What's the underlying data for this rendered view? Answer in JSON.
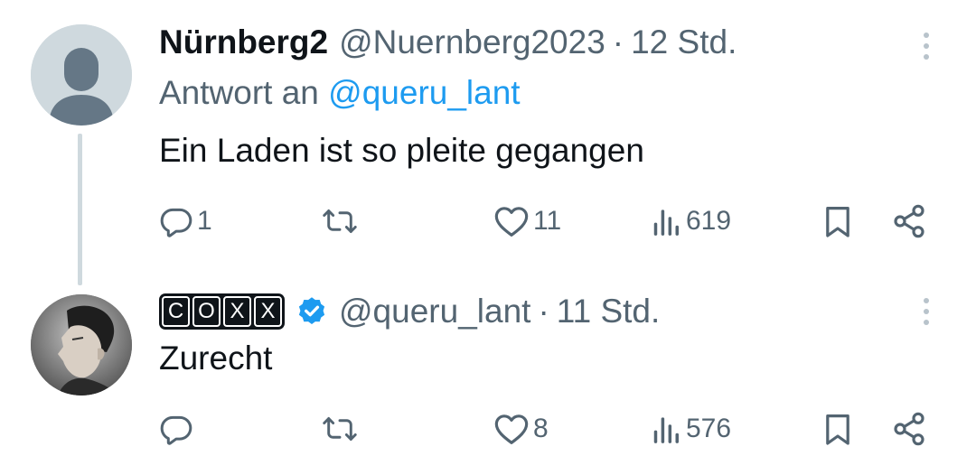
{
  "tweets": [
    {
      "display_name": "Nürnberg2",
      "handle": "@Nuernberg2023",
      "separator": "·",
      "time": "12 Std.",
      "reply_prefix": "Antwort an",
      "reply_mention": "@queru_lant",
      "text": "Ein Laden ist so pleite gegangen",
      "avatar_icon": "default-avatar-icon",
      "counts": {
        "replies": "1",
        "retweets": "",
        "likes": "11",
        "views": "619"
      }
    },
    {
      "display_name_letters": [
        "C",
        "O",
        "X",
        "X"
      ],
      "verified_icon": "verified-badge-icon",
      "handle": "@queru_lant",
      "separator": "·",
      "time": "11 Std.",
      "text": "Zurecht",
      "avatar_icon": "profile-photo",
      "counts": {
        "replies": "",
        "retweets": "",
        "likes": "8",
        "views": "576"
      }
    }
  ],
  "icons": {
    "reply": "reply-icon",
    "retweet": "retweet-icon",
    "like": "heart-icon",
    "views": "views-icon",
    "bookmark": "bookmark-icon",
    "share": "share-icon",
    "more": "more-options-icon"
  },
  "colors": {
    "text": "#0f1419",
    "secondary": "#536471",
    "link": "#1d9bf0",
    "thread_line": "#cfd9de",
    "verified": "#1d9bf0"
  }
}
